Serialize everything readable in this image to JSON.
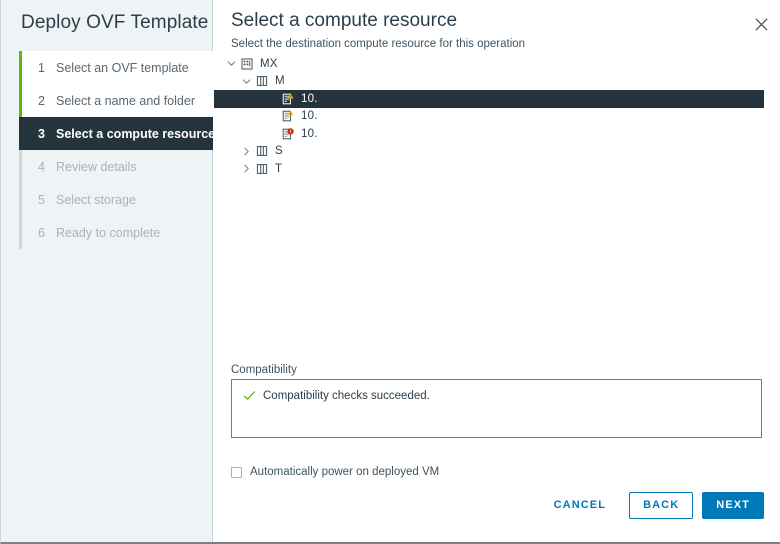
{
  "wizard": {
    "title": "Deploy OVF Template"
  },
  "sidebar": {
    "steps": [
      {
        "num": "1",
        "label": "Select an OVF template",
        "state": "done"
      },
      {
        "num": "2",
        "label": "Select a name and folder",
        "state": "done"
      },
      {
        "num": "3",
        "label": "Select a compute resource",
        "state": "active"
      },
      {
        "num": "4",
        "label": "Review details",
        "state": "pending"
      },
      {
        "num": "5",
        "label": "Select storage",
        "state": "pending"
      },
      {
        "num": "6",
        "label": "Ready to complete",
        "state": "pending"
      }
    ]
  },
  "page": {
    "title": "Select a compute resource",
    "subtitle": "Select the destination compute resource for this operation",
    "close_icon": "close-icon"
  },
  "tree": {
    "nodes": [
      {
        "label": "MX",
        "level": 0,
        "icon": "datacenter-icon",
        "twisty": "chevron-down-icon",
        "expanded": true,
        "selected": false
      },
      {
        "label": "M",
        "level": 1,
        "icon": "cluster-icon",
        "twisty": "chevron-down-icon",
        "expanded": true,
        "selected": false
      },
      {
        "label": "10.",
        "level": 2,
        "icon": "host-warning-icon",
        "twisty": "none",
        "expanded": false,
        "selected": true
      },
      {
        "label": "10.",
        "level": 2,
        "icon": "host-warning-icon",
        "twisty": "none",
        "expanded": false,
        "selected": false
      },
      {
        "label": "10.",
        "level": 2,
        "icon": "host-error-icon",
        "twisty": "none",
        "expanded": false,
        "selected": false
      },
      {
        "label": "S",
        "level": 1,
        "icon": "cluster-icon",
        "twisty": "chevron-right-icon",
        "expanded": false,
        "selected": false
      },
      {
        "label": "T",
        "level": 1,
        "icon": "cluster-icon",
        "twisty": "chevron-right-icon",
        "expanded": false,
        "selected": false
      }
    ]
  },
  "compatibility": {
    "label": "Compatibility",
    "status_icon": "check-icon",
    "message": "Compatibility checks succeeded."
  },
  "options": {
    "auto_power_label": "Automatically power on deployed VM",
    "auto_power_checked": false
  },
  "footer": {
    "cancel_label": "CANCEL",
    "back_label": "BACK",
    "next_label": "NEXT"
  },
  "colors": {
    "accent_blue": "#0079b8",
    "active_step_bg": "#25333d",
    "done_step_bar": "#60b515",
    "sidebar_bg": "#eef3f5",
    "success_green": "#60b515",
    "warning_yellow": "#f5c200",
    "error_red": "#e02200"
  }
}
